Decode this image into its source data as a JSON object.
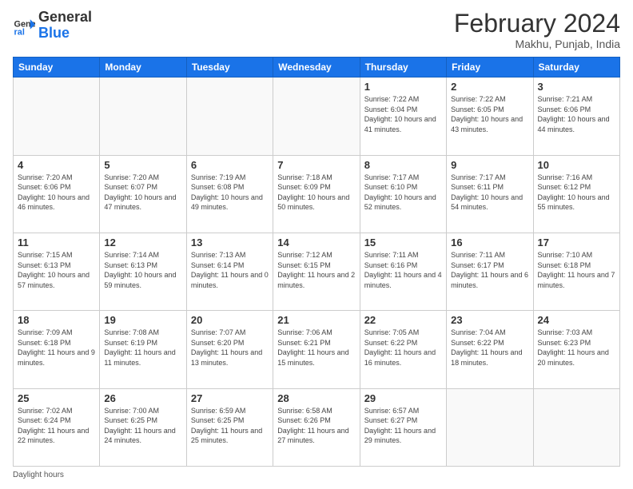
{
  "logo": {
    "line1": "General",
    "line2": "Blue"
  },
  "title": "February 2024",
  "location": "Makhu, Punjab, India",
  "days_header": [
    "Sunday",
    "Monday",
    "Tuesday",
    "Wednesday",
    "Thursday",
    "Friday",
    "Saturday"
  ],
  "weeks": [
    [
      {
        "num": "",
        "info": ""
      },
      {
        "num": "",
        "info": ""
      },
      {
        "num": "",
        "info": ""
      },
      {
        "num": "",
        "info": ""
      },
      {
        "num": "1",
        "info": "Sunrise: 7:22 AM\nSunset: 6:04 PM\nDaylight: 10 hours and 41 minutes."
      },
      {
        "num": "2",
        "info": "Sunrise: 7:22 AM\nSunset: 6:05 PM\nDaylight: 10 hours and 43 minutes."
      },
      {
        "num": "3",
        "info": "Sunrise: 7:21 AM\nSunset: 6:06 PM\nDaylight: 10 hours and 44 minutes."
      }
    ],
    [
      {
        "num": "4",
        "info": "Sunrise: 7:20 AM\nSunset: 6:06 PM\nDaylight: 10 hours and 46 minutes."
      },
      {
        "num": "5",
        "info": "Sunrise: 7:20 AM\nSunset: 6:07 PM\nDaylight: 10 hours and 47 minutes."
      },
      {
        "num": "6",
        "info": "Sunrise: 7:19 AM\nSunset: 6:08 PM\nDaylight: 10 hours and 49 minutes."
      },
      {
        "num": "7",
        "info": "Sunrise: 7:18 AM\nSunset: 6:09 PM\nDaylight: 10 hours and 50 minutes."
      },
      {
        "num": "8",
        "info": "Sunrise: 7:17 AM\nSunset: 6:10 PM\nDaylight: 10 hours and 52 minutes."
      },
      {
        "num": "9",
        "info": "Sunrise: 7:17 AM\nSunset: 6:11 PM\nDaylight: 10 hours and 54 minutes."
      },
      {
        "num": "10",
        "info": "Sunrise: 7:16 AM\nSunset: 6:12 PM\nDaylight: 10 hours and 55 minutes."
      }
    ],
    [
      {
        "num": "11",
        "info": "Sunrise: 7:15 AM\nSunset: 6:13 PM\nDaylight: 10 hours and 57 minutes."
      },
      {
        "num": "12",
        "info": "Sunrise: 7:14 AM\nSunset: 6:13 PM\nDaylight: 10 hours and 59 minutes."
      },
      {
        "num": "13",
        "info": "Sunrise: 7:13 AM\nSunset: 6:14 PM\nDaylight: 11 hours and 0 minutes."
      },
      {
        "num": "14",
        "info": "Sunrise: 7:12 AM\nSunset: 6:15 PM\nDaylight: 11 hours and 2 minutes."
      },
      {
        "num": "15",
        "info": "Sunrise: 7:11 AM\nSunset: 6:16 PM\nDaylight: 11 hours and 4 minutes."
      },
      {
        "num": "16",
        "info": "Sunrise: 7:11 AM\nSunset: 6:17 PM\nDaylight: 11 hours and 6 minutes."
      },
      {
        "num": "17",
        "info": "Sunrise: 7:10 AM\nSunset: 6:18 PM\nDaylight: 11 hours and 7 minutes."
      }
    ],
    [
      {
        "num": "18",
        "info": "Sunrise: 7:09 AM\nSunset: 6:18 PM\nDaylight: 11 hours and 9 minutes."
      },
      {
        "num": "19",
        "info": "Sunrise: 7:08 AM\nSunset: 6:19 PM\nDaylight: 11 hours and 11 minutes."
      },
      {
        "num": "20",
        "info": "Sunrise: 7:07 AM\nSunset: 6:20 PM\nDaylight: 11 hours and 13 minutes."
      },
      {
        "num": "21",
        "info": "Sunrise: 7:06 AM\nSunset: 6:21 PM\nDaylight: 11 hours and 15 minutes."
      },
      {
        "num": "22",
        "info": "Sunrise: 7:05 AM\nSunset: 6:22 PM\nDaylight: 11 hours and 16 minutes."
      },
      {
        "num": "23",
        "info": "Sunrise: 7:04 AM\nSunset: 6:22 PM\nDaylight: 11 hours and 18 minutes."
      },
      {
        "num": "24",
        "info": "Sunrise: 7:03 AM\nSunset: 6:23 PM\nDaylight: 11 hours and 20 minutes."
      }
    ],
    [
      {
        "num": "25",
        "info": "Sunrise: 7:02 AM\nSunset: 6:24 PM\nDaylight: 11 hours and 22 minutes."
      },
      {
        "num": "26",
        "info": "Sunrise: 7:00 AM\nSunset: 6:25 PM\nDaylight: 11 hours and 24 minutes."
      },
      {
        "num": "27",
        "info": "Sunrise: 6:59 AM\nSunset: 6:25 PM\nDaylight: 11 hours and 25 minutes."
      },
      {
        "num": "28",
        "info": "Sunrise: 6:58 AM\nSunset: 6:26 PM\nDaylight: 11 hours and 27 minutes."
      },
      {
        "num": "29",
        "info": "Sunrise: 6:57 AM\nSunset: 6:27 PM\nDaylight: 11 hours and 29 minutes."
      },
      {
        "num": "",
        "info": ""
      },
      {
        "num": "",
        "info": ""
      }
    ]
  ],
  "footer": "Daylight hours"
}
